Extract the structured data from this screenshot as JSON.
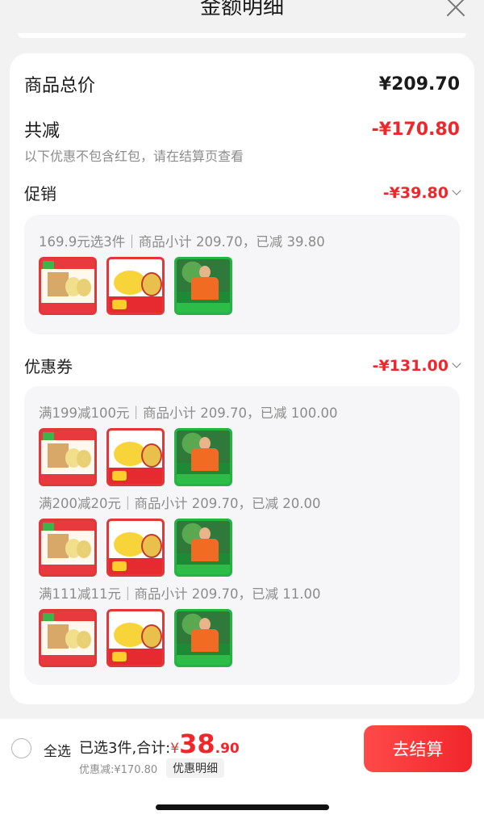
{
  "sheet": {
    "title": "金额明细"
  },
  "summary": {
    "total_label": "商品总价",
    "total_value": "¥209.70",
    "discount_label": "共减",
    "discount_value": "-¥170.80",
    "note": "以下优惠不包含红包，请在结算页查看"
  },
  "promotion": {
    "label": "促销",
    "amount": "-¥39.80",
    "groups": [
      {
        "condition": "169.9元选3件｜商品小计 209.70，已减 39.80"
      }
    ]
  },
  "coupon": {
    "label": "优惠券",
    "amount": "-¥131.00",
    "groups": [
      {
        "condition": "满199减100元｜商品小计 209.70，已减 100.00"
      },
      {
        "condition": "满200减20元｜商品小计 209.70，已减 20.00"
      },
      {
        "condition": "满111减11元｜商品小计 209.70，已减 11.00"
      }
    ]
  },
  "product_icons": [
    "pear-gift-box-thumb",
    "yellow-fruit-thumb",
    "orchard-farmer-thumb"
  ],
  "bottom_bar": {
    "select_all": "全选",
    "selected_text": "已选3件,合计:",
    "currency": "¥",
    "total_int": "38",
    "total_dec": ".90",
    "discount_text": "优惠减:¥170.80",
    "detail_tag": "优惠明细",
    "checkout_label": "去结算"
  },
  "colors": {
    "accent": "#f0262b",
    "background": "#f2f2f2",
    "panel": "#f6f6f8"
  }
}
